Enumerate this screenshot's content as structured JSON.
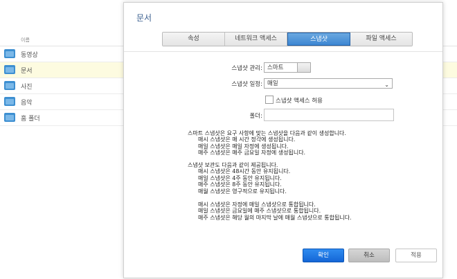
{
  "background": {
    "column_header": "이름",
    "top_faint_text": "",
    "shares": [
      {
        "label": "동영상",
        "icon": "video-folder-icon"
      },
      {
        "label": "문서",
        "icon": "document-folder-icon",
        "selected": true
      },
      {
        "label": "사진",
        "icon": "photo-folder-icon"
      },
      {
        "label": "음악",
        "icon": "music-folder-icon"
      },
      {
        "label": "홈 폴더",
        "icon": "home-folder-icon"
      }
    ]
  },
  "dialog": {
    "title": "문서",
    "tabs": [
      "속성",
      "네트워크 액세스",
      "스냅샷",
      "파일 액세스"
    ],
    "active_tab": "스냅샷",
    "snapshot_mgmt_label": "스냅샷 관리:",
    "snapshot_mgmt_value": "스마트",
    "snapshot_schedule_label": "스냅샷 일정:",
    "snapshot_schedule_value": "매일",
    "allow_access_label": "스냅샷 액세스 허용",
    "folder_label": "폴더:",
    "info_block1": {
      "heading": "스마트 스냅샷은 요구 사항에 맞는 스냅샷을 다음과 같이 생성합니다.",
      "lines": [
        "매시 스냅샷은 매 시간 정각에 생성됩니다.",
        "매일 스냅샷은 매일 자정에 생성됩니다.",
        "매주 스냅샷은 매주 금요일 자정에 생성됩니다."
      ]
    },
    "info_block2": {
      "heading": "스냅샷 보관도 다음과 같이 제공됩니다.",
      "lines": [
        "매시 스냅샷은 48시간 동안 유지됩니다.",
        "매일 스냅샷은 4주 동안 유지됩니다.",
        "매주 스냅샷은 8주 동안 유지됩니다.",
        "매월 스냅샷은 영구적으로 유지됩니다."
      ]
    },
    "info_block3": {
      "lines": [
        "매시 스냅샷은 자정에 매일 스냅샷으로 통합됩니다.",
        "매일 스냅샷은 금요일에 매주 스냅샷으로 통합됩니다.",
        "매주 스냅샷은 해당 월의 마지막 날에 매월 스냅샷으로 통합됩니다."
      ]
    },
    "buttons": {
      "ok": "확인",
      "cancel": "취소",
      "apply": "적용"
    }
  }
}
